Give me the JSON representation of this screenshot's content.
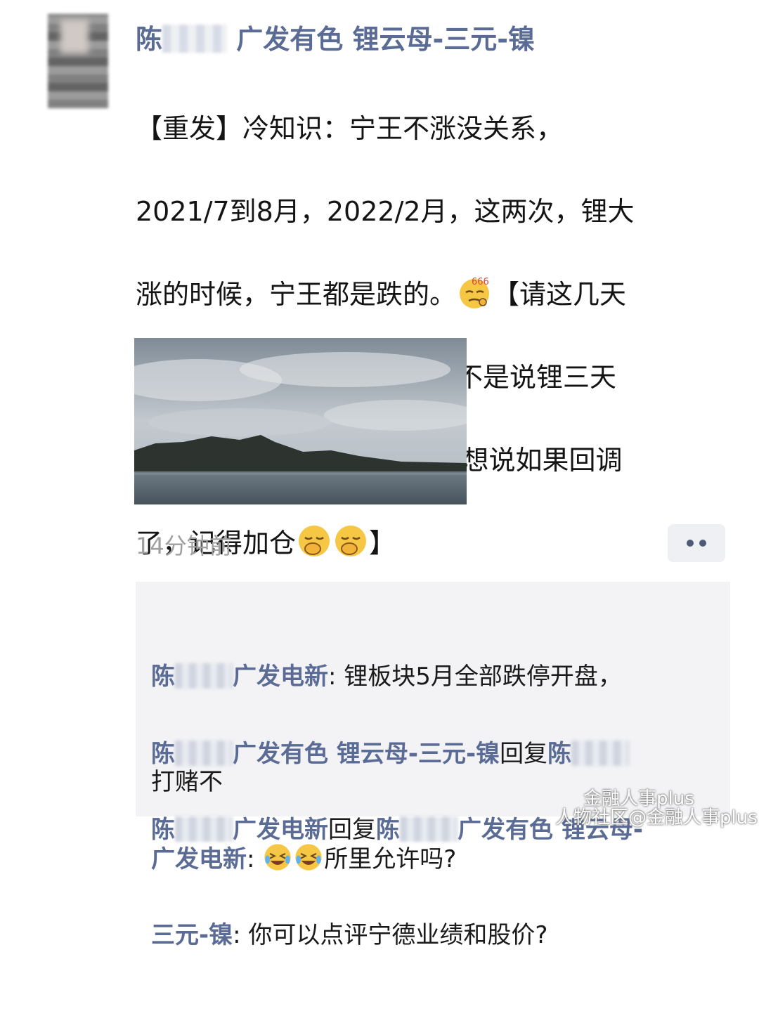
{
  "post": {
    "author_prefix": "陈",
    "author_suffix": " 广发有色 锂云母-三元-镍",
    "text_line1": "【重发】冷知识：宁王不涨没关系，",
    "text_line2": "2021/7到8月，2022/2月，这两次，锂大",
    "text_line3a": "涨的时候，宁王都是跌的。",
    "text_line3b": "【请这几天",
    "text_line4": "买了锂的大佬安心过节，我不是说锂三天",
    "text_line5": "大涨30%不会回调一点，是想说如果回调",
    "text_line6a": "了，记得加仓",
    "text_line6b": "】",
    "emoji_666_label": "666",
    "time": "14分钟前"
  },
  "comments": [
    {
      "author_prefix": "陈",
      "author_suffix": "广发电新",
      "text_line1": ": 锂板块5月全部跌停开盘，",
      "text_line2": "打赌不"
    },
    {
      "author_prefix": "陈",
      "author_suffix": "广发有色 锂云母-三元-镍",
      "reply_word": "回复",
      "reply_prefix": "陈",
      "reply_suffix_line2": "广发电新",
      "text": ": ",
      "text_after": "所里允许吗?"
    },
    {
      "author_prefix": "陈",
      "author_suffix": "广发电新",
      "reply_word": "回复",
      "reply_prefix": "陈",
      "reply_suffix": "广发有色 锂云母-",
      "reply_suffix_line2": "三元-镍",
      "text": ": 你可以点评宁德业绩和股价?"
    }
  ],
  "watermark": {
    "line1": "金融人事plus",
    "line2": "人物社区@金融人事plus"
  },
  "colors": {
    "name_blue": "#5a6b95",
    "time_gray": "#a0a0a0",
    "comment_bg": "#f3f3f5"
  },
  "icons": [
    "avatar",
    "emoji-666-icon",
    "emoji-smirk-icon",
    "emoji-laugh-cry-icon",
    "more-dots-icon"
  ]
}
